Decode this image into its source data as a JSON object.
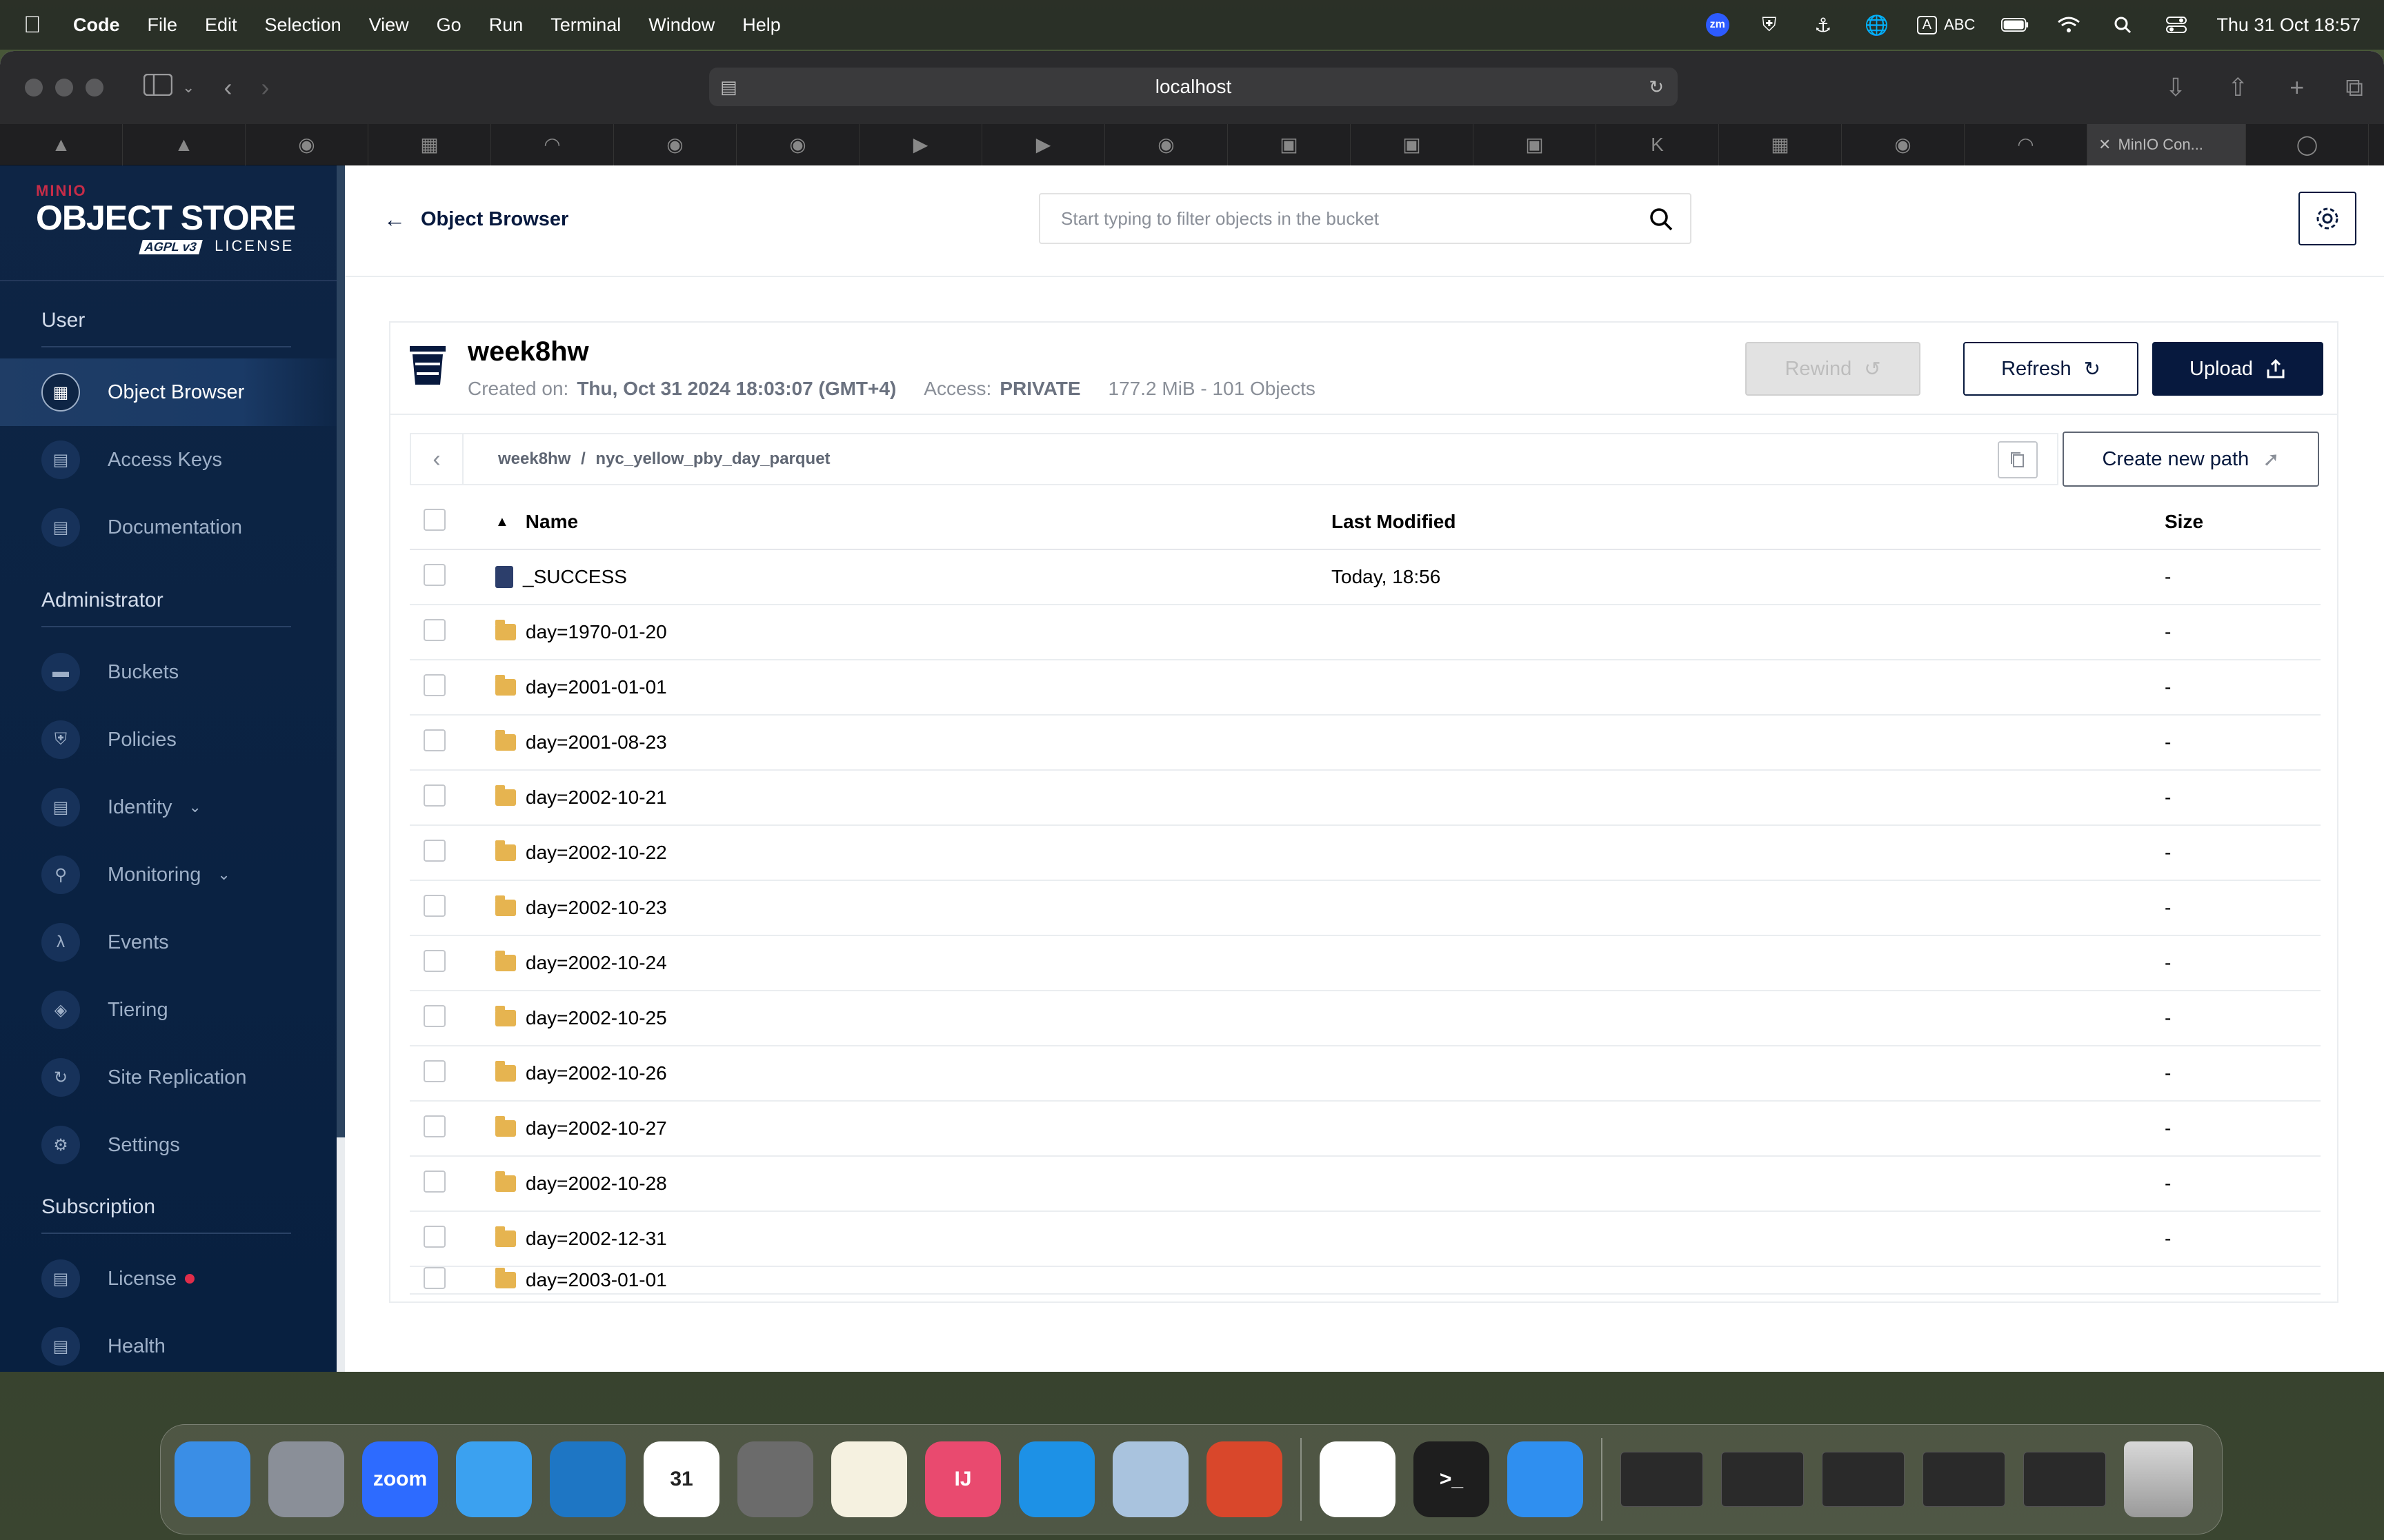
{
  "menubar": {
    "app_name": "Code",
    "items": [
      "File",
      "Edit",
      "Selection",
      "View",
      "Go",
      "Run",
      "Terminal",
      "Window",
      "Help"
    ],
    "status": {
      "zoom_badge": "zm",
      "input_source": "A",
      "input_label": "ABC",
      "datetime": "Thu 31 Oct  18:57"
    }
  },
  "browser": {
    "url": "localhost",
    "active_tab": "MinIO Con..."
  },
  "sidebar": {
    "logo": {
      "brand": "MINIO",
      "product": "OBJECT STORE",
      "license_badge": "AGPL v3",
      "license_label": "LICENSE"
    },
    "sections": [
      {
        "title": "User",
        "items": [
          {
            "label": "Object Browser",
            "icon": "object-browser-icon",
            "active": true
          },
          {
            "label": "Access Keys",
            "icon": "access-keys-icon"
          },
          {
            "label": "Documentation",
            "icon": "documentation-icon"
          }
        ]
      },
      {
        "title": "Administrator",
        "items": [
          {
            "label": "Buckets",
            "icon": "buckets-icon"
          },
          {
            "label": "Policies",
            "icon": "policies-icon"
          },
          {
            "label": "Identity",
            "icon": "identity-icon",
            "expandable": true
          },
          {
            "label": "Monitoring",
            "icon": "monitoring-icon",
            "expandable": true
          },
          {
            "label": "Events",
            "icon": "lambda-icon"
          },
          {
            "label": "Tiering",
            "icon": "tiering-icon"
          },
          {
            "label": "Site Replication",
            "icon": "site-replication-icon"
          },
          {
            "label": "Settings",
            "icon": "settings-icon"
          }
        ]
      },
      {
        "title": "Subscription",
        "items": [
          {
            "label": "License",
            "icon": "license-icon",
            "alert_dot": true
          },
          {
            "label": "Health",
            "icon": "health-icon"
          }
        ]
      }
    ]
  },
  "topbar": {
    "back_label": "Object Browser",
    "filter_placeholder": "Start typing to filter objects in the bucket"
  },
  "bucket": {
    "name": "week8hw",
    "created_label": "Created on:",
    "created_value": "Thu, Oct 31 2024 18:03:07 (GMT+4)",
    "access_label": "Access:",
    "access_value": "PRIVATE",
    "summary": "177.2 MiB - 101 Objects",
    "buttons": {
      "rewind": "Rewind",
      "refresh": "Refresh",
      "upload": "Upload"
    }
  },
  "path": {
    "bucket": "week8hw",
    "separator": "/",
    "folder": "nyc_yellow_pby_day_parquet",
    "create_label": "Create new path"
  },
  "table": {
    "headers": {
      "name": "Name",
      "modified": "Last Modified",
      "size": "Size"
    },
    "rows": [
      {
        "type": "file",
        "name": "_SUCCESS",
        "modified": "Today, 18:56",
        "size": "-"
      },
      {
        "type": "folder",
        "name": "day=1970-01-20",
        "modified": "",
        "size": "-"
      },
      {
        "type": "folder",
        "name": "day=2001-01-01",
        "modified": "",
        "size": "-"
      },
      {
        "type": "folder",
        "name": "day=2001-08-23",
        "modified": "",
        "size": "-"
      },
      {
        "type": "folder",
        "name": "day=2002-10-21",
        "modified": "",
        "size": "-"
      },
      {
        "type": "folder",
        "name": "day=2002-10-22",
        "modified": "",
        "size": "-"
      },
      {
        "type": "folder",
        "name": "day=2002-10-23",
        "modified": "",
        "size": "-"
      },
      {
        "type": "folder",
        "name": "day=2002-10-24",
        "modified": "",
        "size": "-"
      },
      {
        "type": "folder",
        "name": "day=2002-10-25",
        "modified": "",
        "size": "-"
      },
      {
        "type": "folder",
        "name": "day=2002-10-26",
        "modified": "",
        "size": "-"
      },
      {
        "type": "folder",
        "name": "day=2002-10-27",
        "modified": "",
        "size": "-"
      },
      {
        "type": "folder",
        "name": "day=2002-10-28",
        "modified": "",
        "size": "-"
      },
      {
        "type": "folder",
        "name": "day=2002-12-31",
        "modified": "",
        "size": "-"
      },
      {
        "type": "folder",
        "name": "day=2003-01-01",
        "modified": "",
        "size": ""
      }
    ]
  },
  "dock": {
    "apps": [
      {
        "name": "finder-icon",
        "color": "#3a8ee6",
        "label": ""
      },
      {
        "name": "launchpad-icon",
        "color": "#8a8f98",
        "label": ""
      },
      {
        "name": "zoom-icon",
        "color": "#2d6bff",
        "label": "zoom"
      },
      {
        "name": "safari-icon",
        "color": "#3ba1f0",
        "label": ""
      },
      {
        "name": "vscode-icon",
        "color": "#1e76c4",
        "label": ""
      },
      {
        "name": "calendar-icon",
        "color": "#ffffff",
        "label": "31"
      },
      {
        "name": "system-settings-icon",
        "color": "#6b6b6b",
        "label": ""
      },
      {
        "name": "notes-icon",
        "color": "#f5f1e0",
        "label": ""
      },
      {
        "name": "intellij-icon",
        "color": "#e94a6f",
        "label": "IJ"
      },
      {
        "name": "docker-icon",
        "color": "#1d91e6",
        "label": ""
      },
      {
        "name": "pgadmin-icon",
        "color": "#a9c3de",
        "label": ""
      },
      {
        "name": "remote-desktop-icon",
        "color": "#d9472b",
        "label": ""
      }
    ],
    "apps2": [
      {
        "name": "slack-icon",
        "color": "#ffffff",
        "label": ""
      },
      {
        "name": "terminal-icon",
        "color": "#1e1e1e",
        "label": ">_"
      },
      {
        "name": "keynote-icon",
        "color": "#2f8ff0",
        "label": ""
      }
    ]
  }
}
